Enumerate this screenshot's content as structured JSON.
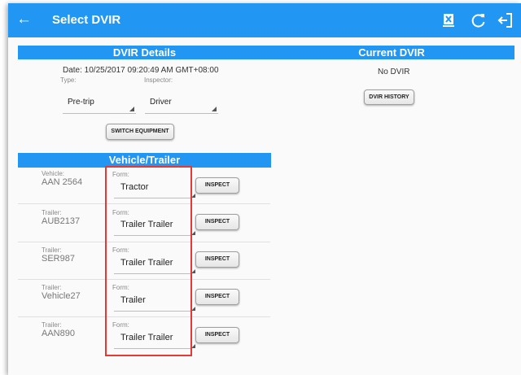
{
  "appbar": {
    "title": "Select DVIR"
  },
  "dvir_details": {
    "header": "DVIR Details",
    "date": "Date: 10/25/2017 09:20:49 AM GMT+08:00",
    "type_label": "Type:",
    "inspector_label": "Inspector:",
    "type_value": "Pre-trip",
    "inspector_value": "Driver",
    "switch_button": "SWITCH EQUIPMENT"
  },
  "current_dvir": {
    "header": "Current DVIR",
    "status": "No DVIR",
    "history_button": "DVIR HISTORY"
  },
  "vehicle_trailer": {
    "header": "Vehicle/Trailer",
    "form_label": "Form:",
    "inspect_label": "INSPECT",
    "rows": [
      {
        "label": "Vehicle:",
        "id": "AAN 2564",
        "form": "Tractor"
      },
      {
        "label": "Trailer:",
        "id": "AUB2137",
        "form": "Trailer Trailer"
      },
      {
        "label": "Trailer:",
        "id": "SER987",
        "form": "Trailer Trailer"
      },
      {
        "label": "Trailer:",
        "id": "Vehicle27",
        "form": "Trailer"
      },
      {
        "label": "Trailer:",
        "id": "AAN890",
        "form": "Trailer Trailer"
      }
    ]
  },
  "icons": [
    "back-arrow-icon",
    "clear-equipment-icon",
    "refresh-icon",
    "logout-icon"
  ]
}
